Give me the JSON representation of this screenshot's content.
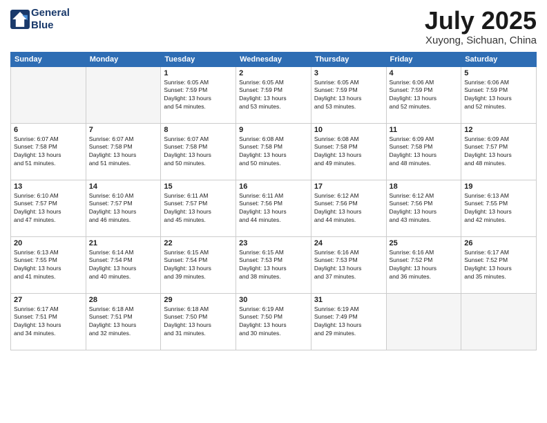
{
  "header": {
    "logo_line1": "General",
    "logo_line2": "Blue",
    "month": "July 2025",
    "location": "Xuyong, Sichuan, China"
  },
  "days_of_week": [
    "Sunday",
    "Monday",
    "Tuesday",
    "Wednesday",
    "Thursday",
    "Friday",
    "Saturday"
  ],
  "weeks": [
    [
      {
        "day": "",
        "info": ""
      },
      {
        "day": "",
        "info": ""
      },
      {
        "day": "1",
        "info": "Sunrise: 6:05 AM\nSunset: 7:59 PM\nDaylight: 13 hours\nand 54 minutes."
      },
      {
        "day": "2",
        "info": "Sunrise: 6:05 AM\nSunset: 7:59 PM\nDaylight: 13 hours\nand 53 minutes."
      },
      {
        "day": "3",
        "info": "Sunrise: 6:05 AM\nSunset: 7:59 PM\nDaylight: 13 hours\nand 53 minutes."
      },
      {
        "day": "4",
        "info": "Sunrise: 6:06 AM\nSunset: 7:59 PM\nDaylight: 13 hours\nand 52 minutes."
      },
      {
        "day": "5",
        "info": "Sunrise: 6:06 AM\nSunset: 7:59 PM\nDaylight: 13 hours\nand 52 minutes."
      }
    ],
    [
      {
        "day": "6",
        "info": "Sunrise: 6:07 AM\nSunset: 7:58 PM\nDaylight: 13 hours\nand 51 minutes."
      },
      {
        "day": "7",
        "info": "Sunrise: 6:07 AM\nSunset: 7:58 PM\nDaylight: 13 hours\nand 51 minutes."
      },
      {
        "day": "8",
        "info": "Sunrise: 6:07 AM\nSunset: 7:58 PM\nDaylight: 13 hours\nand 50 minutes."
      },
      {
        "day": "9",
        "info": "Sunrise: 6:08 AM\nSunset: 7:58 PM\nDaylight: 13 hours\nand 50 minutes."
      },
      {
        "day": "10",
        "info": "Sunrise: 6:08 AM\nSunset: 7:58 PM\nDaylight: 13 hours\nand 49 minutes."
      },
      {
        "day": "11",
        "info": "Sunrise: 6:09 AM\nSunset: 7:58 PM\nDaylight: 13 hours\nand 48 minutes."
      },
      {
        "day": "12",
        "info": "Sunrise: 6:09 AM\nSunset: 7:57 PM\nDaylight: 13 hours\nand 48 minutes."
      }
    ],
    [
      {
        "day": "13",
        "info": "Sunrise: 6:10 AM\nSunset: 7:57 PM\nDaylight: 13 hours\nand 47 minutes."
      },
      {
        "day": "14",
        "info": "Sunrise: 6:10 AM\nSunset: 7:57 PM\nDaylight: 13 hours\nand 46 minutes."
      },
      {
        "day": "15",
        "info": "Sunrise: 6:11 AM\nSunset: 7:57 PM\nDaylight: 13 hours\nand 45 minutes."
      },
      {
        "day": "16",
        "info": "Sunrise: 6:11 AM\nSunset: 7:56 PM\nDaylight: 13 hours\nand 44 minutes."
      },
      {
        "day": "17",
        "info": "Sunrise: 6:12 AM\nSunset: 7:56 PM\nDaylight: 13 hours\nand 44 minutes."
      },
      {
        "day": "18",
        "info": "Sunrise: 6:12 AM\nSunset: 7:56 PM\nDaylight: 13 hours\nand 43 minutes."
      },
      {
        "day": "19",
        "info": "Sunrise: 6:13 AM\nSunset: 7:55 PM\nDaylight: 13 hours\nand 42 minutes."
      }
    ],
    [
      {
        "day": "20",
        "info": "Sunrise: 6:13 AM\nSunset: 7:55 PM\nDaylight: 13 hours\nand 41 minutes."
      },
      {
        "day": "21",
        "info": "Sunrise: 6:14 AM\nSunset: 7:54 PM\nDaylight: 13 hours\nand 40 minutes."
      },
      {
        "day": "22",
        "info": "Sunrise: 6:15 AM\nSunset: 7:54 PM\nDaylight: 13 hours\nand 39 minutes."
      },
      {
        "day": "23",
        "info": "Sunrise: 6:15 AM\nSunset: 7:53 PM\nDaylight: 13 hours\nand 38 minutes."
      },
      {
        "day": "24",
        "info": "Sunrise: 6:16 AM\nSunset: 7:53 PM\nDaylight: 13 hours\nand 37 minutes."
      },
      {
        "day": "25",
        "info": "Sunrise: 6:16 AM\nSunset: 7:52 PM\nDaylight: 13 hours\nand 36 minutes."
      },
      {
        "day": "26",
        "info": "Sunrise: 6:17 AM\nSunset: 7:52 PM\nDaylight: 13 hours\nand 35 minutes."
      }
    ],
    [
      {
        "day": "27",
        "info": "Sunrise: 6:17 AM\nSunset: 7:51 PM\nDaylight: 13 hours\nand 34 minutes."
      },
      {
        "day": "28",
        "info": "Sunrise: 6:18 AM\nSunset: 7:51 PM\nDaylight: 13 hours\nand 32 minutes."
      },
      {
        "day": "29",
        "info": "Sunrise: 6:18 AM\nSunset: 7:50 PM\nDaylight: 13 hours\nand 31 minutes."
      },
      {
        "day": "30",
        "info": "Sunrise: 6:19 AM\nSunset: 7:50 PM\nDaylight: 13 hours\nand 30 minutes."
      },
      {
        "day": "31",
        "info": "Sunrise: 6:19 AM\nSunset: 7:49 PM\nDaylight: 13 hours\nand 29 minutes."
      },
      {
        "day": "",
        "info": ""
      },
      {
        "day": "",
        "info": ""
      }
    ]
  ]
}
